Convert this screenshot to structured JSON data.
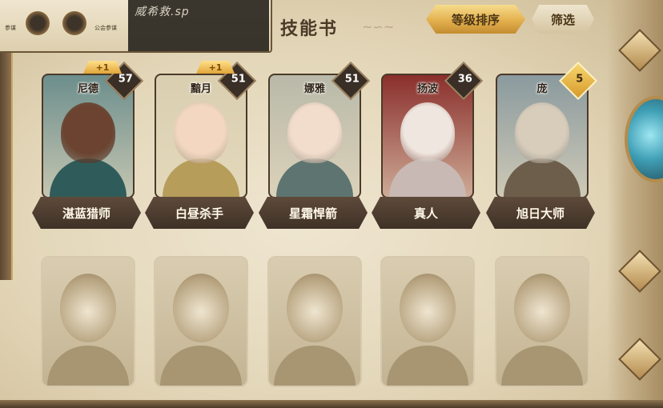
{
  "top_panel": {
    "watermark": "威希救.sp",
    "left_label_1": "参谋",
    "left_label_2": "公会参谋"
  },
  "header": {
    "title": "技能书",
    "sort_label": "等级排序",
    "filter_label": "筛选"
  },
  "heroes": [
    {
      "name": "尼德",
      "level": "57",
      "bonus": "+1",
      "title": "湛蓝猎师",
      "colors": {
        "bg": "#6c8e8c",
        "skin": "#6b4330",
        "body": "#2f5c5a"
      }
    },
    {
      "name": "黯月",
      "level": "51",
      "bonus": "+1",
      "title": "白昼杀手",
      "colors": {
        "bg": "#d9cfb0",
        "skin": "#f3d7c0",
        "body": "#b79d5a"
      }
    },
    {
      "name": "娜雅",
      "level": "51",
      "bonus": "",
      "title": "星霜悍箭",
      "colors": {
        "bg": "#b9b9a9",
        "skin": "#f2dccb",
        "body": "#5e7470"
      }
    },
    {
      "name": "扬波",
      "level": "36",
      "bonus": "",
      "title": "真人",
      "colors": {
        "bg": "#8a2f2c",
        "skin": "#efe6df",
        "body": "#c9b9b4"
      }
    },
    {
      "name": "庞",
      "level": "5",
      "bonus": "",
      "title": "旭日大师",
      "colors": {
        "bg": "#8a9a9e",
        "skin": "#d8cdbb",
        "body": "#6d5e4b"
      }
    }
  ],
  "locked_heroes": [
    {
      "slot": "locked-hero-1"
    },
    {
      "slot": "locked-hero-2"
    },
    {
      "slot": "locked-hero-3"
    },
    {
      "slot": "locked-hero-4"
    },
    {
      "slot": "locked-hero-5"
    }
  ]
}
